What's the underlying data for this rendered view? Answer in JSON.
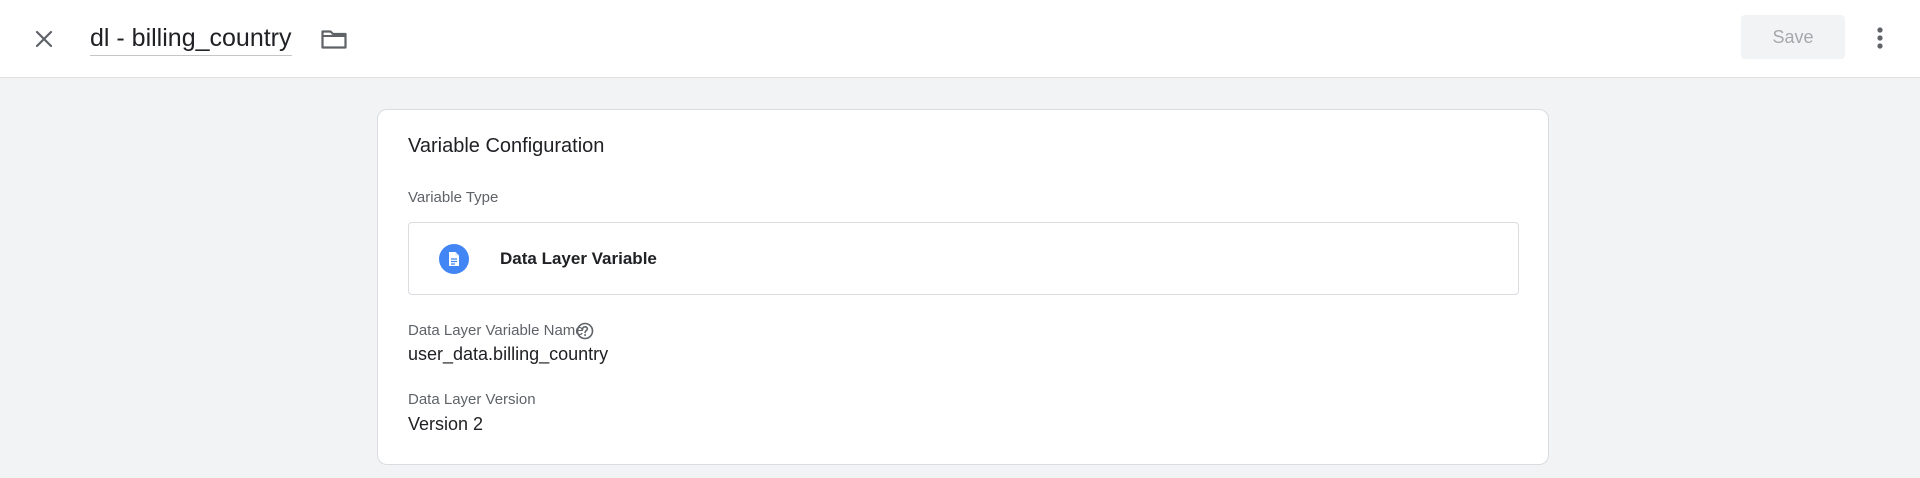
{
  "header": {
    "close_icon": "close-icon",
    "title": "dl - billing_country",
    "folder_icon": "folder-icon",
    "save_label": "Save",
    "more_icon": "more-vert-icon"
  },
  "card": {
    "title": "Variable Configuration",
    "variable_type_label": "Variable Type",
    "variable_type_icon": "document-icon",
    "variable_type_value": "Data Layer Variable",
    "dlv_name_label": "Data Layer Variable Name",
    "dlv_name_help_icon": "help-icon",
    "dlv_name_value": "user_data.billing_country",
    "dlv_version_label": "Data Layer Version",
    "dlv_version_value": "Version 2"
  },
  "colors": {
    "accent": "#4285f4",
    "background": "#f1f3f4",
    "card": "#ffffff",
    "disabled_text": "#a6a8ab"
  }
}
